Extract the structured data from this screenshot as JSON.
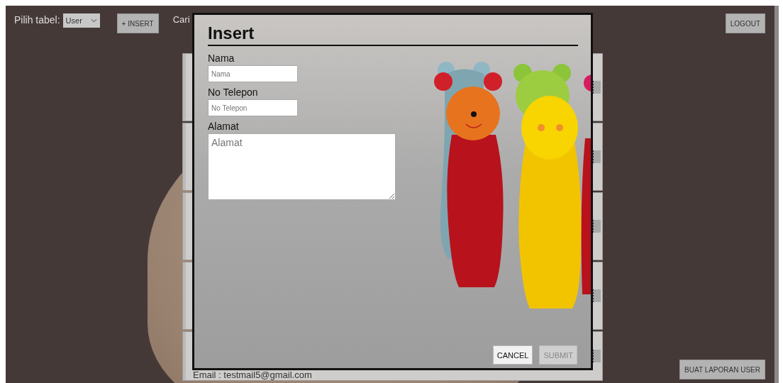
{
  "top_bar": {
    "table_label": "Pilih tabel:",
    "table_select": "User",
    "insert_button": "+ INSERT",
    "search_label": "Cari",
    "logout_button": "LOGOUT"
  },
  "record_cards": [
    {
      "kind": "hidden"
    },
    {
      "kind": "hidden"
    },
    {
      "kind": "hidden"
    },
    {
      "kind": "hidden"
    },
    {
      "kind": "partial",
      "text": "Email : testmail5@gmail.com"
    }
  ],
  "dialog": {
    "title": "Insert",
    "fields": [
      {
        "kind": "input",
        "label": "Nama",
        "placeholder": "Nama"
      },
      {
        "kind": "input",
        "label": "No Telepon",
        "placeholder": "No Telepon"
      },
      {
        "kind": "textarea",
        "label": "Alamat",
        "placeholder": "Alamat"
      }
    ],
    "buttons": [
      {
        "label": "CANCEL",
        "disabled": false
      },
      {
        "label": "SUBMIT",
        "disabled": true
      }
    ]
  },
  "report_button": "BUAT LAPORAN USER"
}
